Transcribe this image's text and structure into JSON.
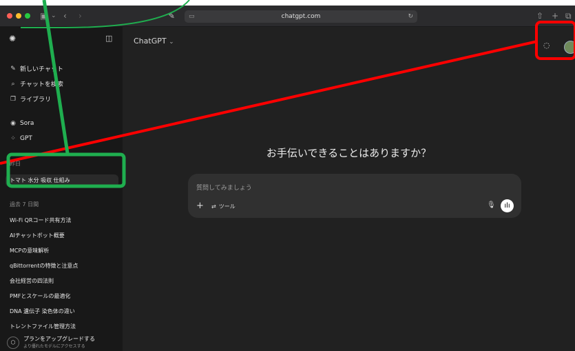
{
  "browser": {
    "url": "chatgpt.com"
  },
  "header": {
    "model_label": "ChatGPT",
    "model_chevron": "⌄"
  },
  "sidebar": {
    "nav": [
      {
        "icon": "new-chat-icon",
        "label": "新しいチャット"
      },
      {
        "icon": "search-icon",
        "label": "チャットを検索"
      },
      {
        "icon": "library-icon",
        "label": "ライブラリ"
      }
    ],
    "apps": [
      {
        "icon": "sora-icon",
        "label": "Sora"
      },
      {
        "icon": "gpt-grid-icon",
        "label": "GPT"
      }
    ],
    "section_yesterday": "昨日",
    "yesterday_chats": [
      "トマト 水分 吸収 仕組み"
    ],
    "section_week": "過去 7 日間",
    "week_chats": [
      "Wi-Fi QRコード共有方法",
      "AIチャットボット概要",
      "MCPの意味解析",
      "qBittorrentの特徴と注意点",
      "会社経営の四法則",
      "PMFとスケールの最適化",
      "DNA 遺伝子 染色体の違い",
      "トレントファイル管理方法"
    ],
    "upgrade_title": "プランをアップグレードする",
    "upgrade_sub": "より優れたモデルにアクセスする"
  },
  "main": {
    "greeting": "お手伝いできることはありますか？",
    "composer_placeholder": "質問してみましょう",
    "tools_label": "ツール"
  },
  "annotations": {
    "green_color": "#1fae4f",
    "red_color": "#ff0000"
  }
}
